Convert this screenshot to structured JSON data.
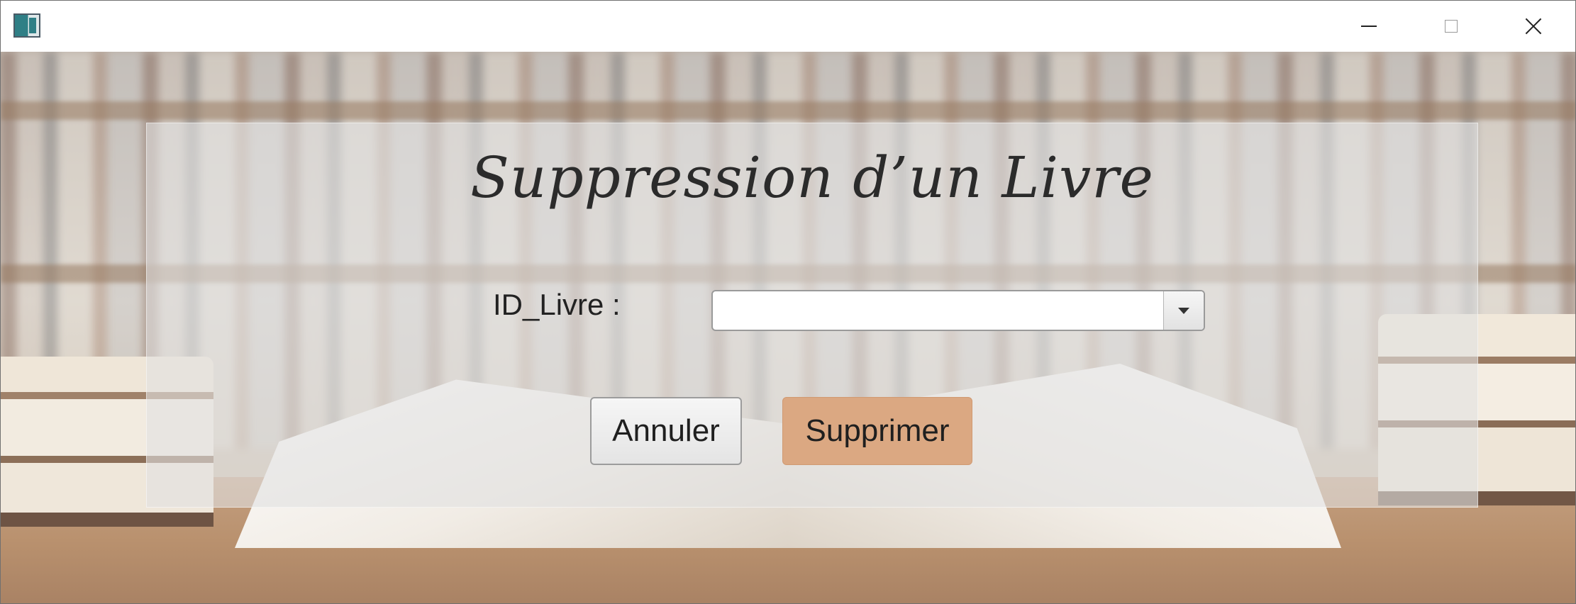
{
  "window": {
    "icon": "app-icon",
    "controls": [
      "minimize-icon",
      "maximize-icon",
      "close-icon"
    ]
  },
  "form": {
    "title": "Suppression d’un Livre",
    "id_label": "ID_Livre :",
    "id_value": "",
    "dropdown_icon": "chevron-down-icon"
  },
  "buttons": {
    "cancel_label": "Annuler",
    "delete_label": "Supprimer"
  },
  "colors": {
    "delete_button": "#dba882",
    "panel_overlay": "rgba(225,225,225,0.6)"
  }
}
